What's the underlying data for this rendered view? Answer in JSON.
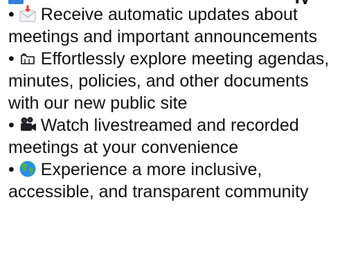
{
  "heading": {
    "partial_text": "ly"
  },
  "benefits": [
    {
      "icon": "envelope-arrow-icon",
      "text": "Receive automatic updates about meetings and important announcements"
    },
    {
      "icon": "card-index-dividers-icon",
      "text": "Effortlessly explore meeting agendas, minutes, policies, and other documents with our new public site"
    },
    {
      "icon": "movie-camera-icon",
      "text": "Watch livestreamed and recorded meetings at your convenience"
    },
    {
      "icon": "globe-icon",
      "text": "Experience a more inclusive, accessible, and transparent community"
    }
  ],
  "colors": {
    "text": "#111111",
    "envelope_arrow": "#e03a2f",
    "envelope": "#c9c9d6",
    "camera": "#1e1e24",
    "globe_ocean": "#2a8ee8",
    "globe_land": "#4caf50"
  }
}
